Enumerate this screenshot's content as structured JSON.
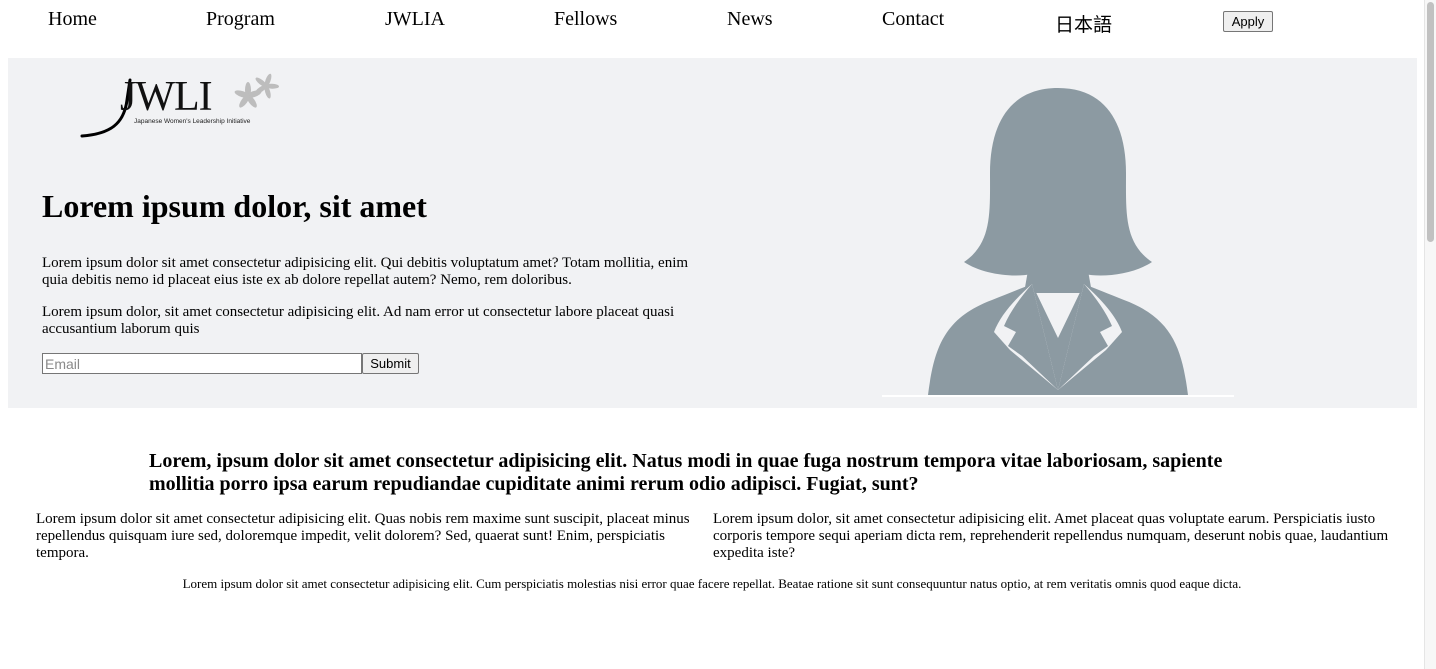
{
  "nav": {
    "home": "Home",
    "program": "Program",
    "jwlia": "JWLIA",
    "fellows": "Fellows",
    "news": "News",
    "contact": "Contact",
    "japanese": "日本語",
    "apply": "Apply"
  },
  "hero": {
    "logo_text": "JWLI",
    "logo_subtitle": "Japanese Women's Leadership Initiative",
    "title": "Lorem ipsum dolor, sit amet",
    "paragraph1": "Lorem ipsum dolor sit amet consectetur adipisicing elit. Qui debitis voluptatum amet? Totam mollitia, enim quia debitis nemo id placeat eius iste ex ab dolore repellat autem? Nemo, rem doloribus.",
    "paragraph2": "Lorem ipsum dolor, sit amet consectetur adipisicing elit. Ad nam error ut consectetur labore placeat quasi accusantium laborum quis",
    "email_placeholder": "Email",
    "submit": "Submit",
    "avatar_icon": "person-silhouette-icon"
  },
  "section": {
    "title": "Lorem, ipsum dolor sit amet consectetur adipisicing elit. Natus modi in quae fuga nostrum tempora vitae laboriosam, sapiente mollitia porro ipsa earum repudiandae cupiditate animi rerum odio adipisci. Fugiat, sunt?",
    "col_left": "Lorem ipsum dolor sit amet consectetur adipisicing elit. Quas nobis rem maxime sunt suscipit, placeat minus repellendus quisquam iure sed, doloremque impedit, velit dolorem? Sed, quaerat sunt! Enim, perspiciatis tempora.",
    "col_right": "Lorem ipsum dolor, sit amet consectetur adipisicing elit. Amet placeat quas voluptate earum. Perspiciatis iusto corporis tempore sequi aperiam dicta rem, reprehenderit repellendus numquam, deserunt nobis quae, laudantium expedita iste?",
    "footer": "Lorem ipsum dolor sit amet consectetur adipisicing elit. Cum perspiciatis molestias nisi error quae facere repellat. Beatae ratione sit sunt consequuntur natus optio, at rem veritatis omnis quod eaque dicta."
  },
  "colors": {
    "hero_bg": "#f1f2f4",
    "avatar": "#8c9aa2",
    "logo_leaf": "#b9b9b9"
  }
}
